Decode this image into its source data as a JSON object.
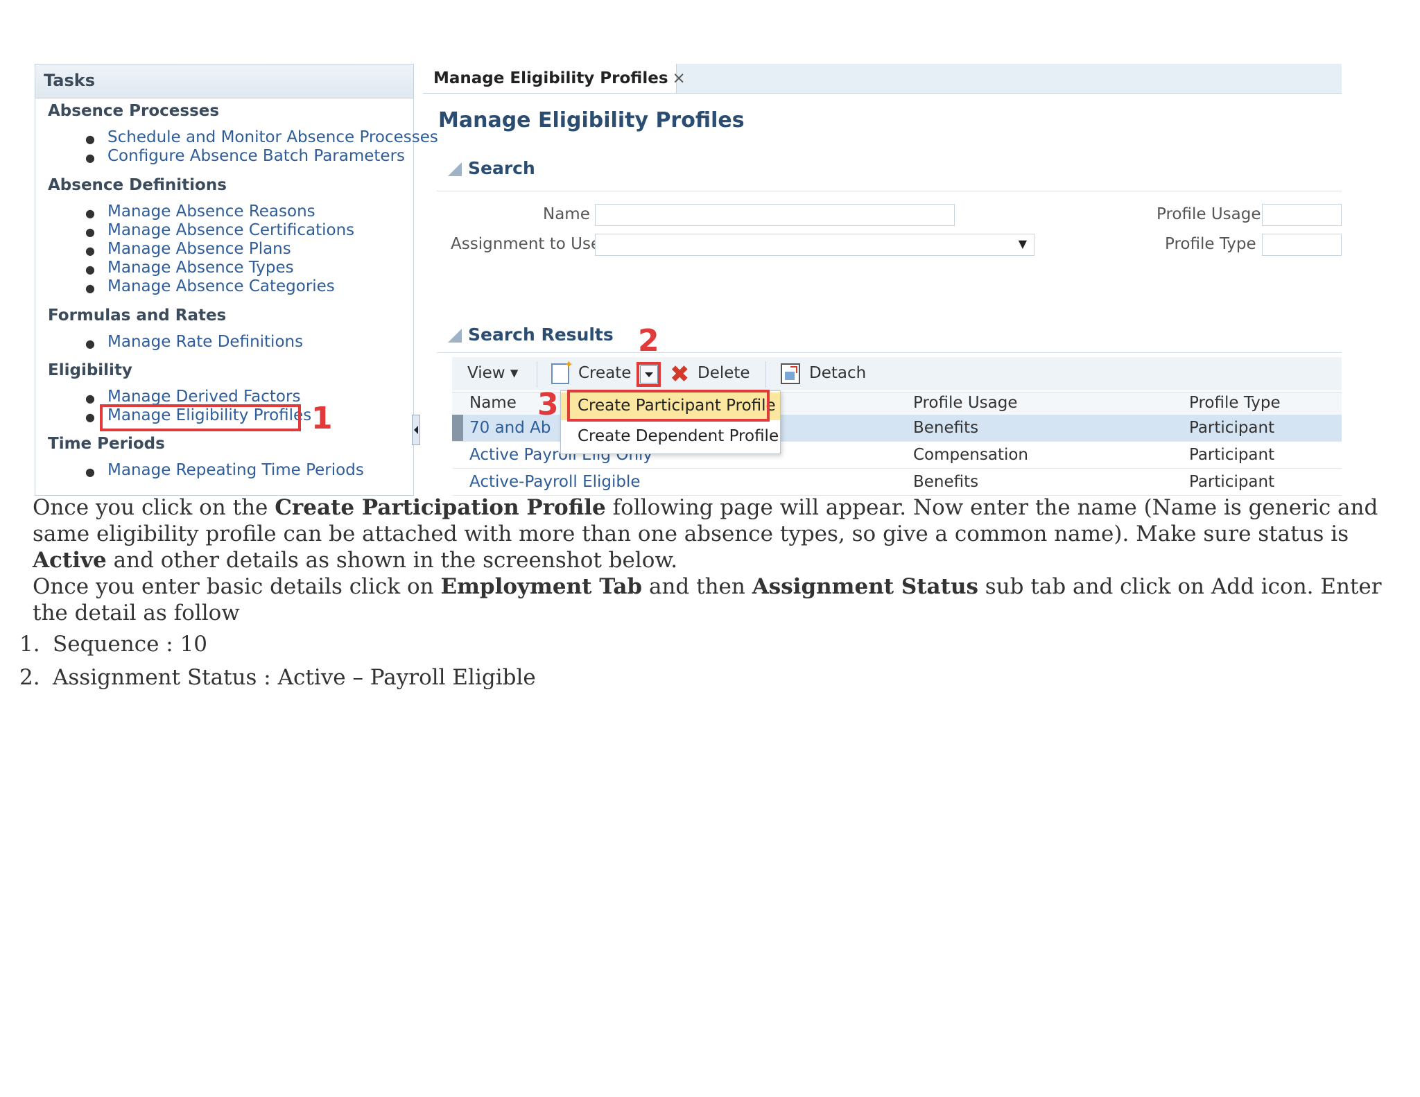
{
  "tasks_panel": {
    "title": "Tasks",
    "groups": [
      {
        "heading": "Absence Processes",
        "links": [
          "Schedule and Monitor Absence Processes",
          "Configure Absence Batch Parameters"
        ]
      },
      {
        "heading": "Absence Definitions",
        "links": [
          "Manage Absence Reasons",
          "Manage Absence Certifications",
          "Manage Absence Plans",
          "Manage Absence Types",
          "Manage Absence Categories"
        ]
      },
      {
        "heading": "Formulas and Rates",
        "links": [
          "Manage Rate Definitions"
        ]
      },
      {
        "heading": "Eligibility",
        "links": [
          "Manage Derived Factors",
          "Manage Eligibility Profiles"
        ]
      },
      {
        "heading": "Time Periods",
        "links": [
          "Manage Repeating Time Periods"
        ]
      }
    ]
  },
  "tab": {
    "label": "Manage Eligibility Profiles",
    "close": "×"
  },
  "page_title": "Manage Eligibility Profiles",
  "search": {
    "heading": "Search",
    "name_label": "Name",
    "assignment_label": "Assignment to Use",
    "profile_usage_label": "Profile Usage",
    "profile_type_label": "Profile Type",
    "select_arrow": "▼"
  },
  "results": {
    "heading": "Search Results",
    "toolbar": {
      "view": "View",
      "create": "Create",
      "delete": "Delete",
      "detach": "Detach"
    },
    "columns": [
      "Name",
      "Profile Usage",
      "Profile Type"
    ],
    "rows": [
      {
        "name": "70 and Ab",
        "usage": "Benefits",
        "type": "Participant"
      },
      {
        "name": "Active Payroll Elig Only",
        "usage": "Compensation",
        "type": "Participant"
      },
      {
        "name": "Active-Payroll Eligible",
        "usage": "Benefits",
        "type": "Participant"
      }
    ]
  },
  "create_menu": {
    "items": [
      "Create Participant Profile",
      "Create Dependent Profile"
    ]
  },
  "callouts": [
    "1",
    "2",
    "3"
  ],
  "document": {
    "para1": {
      "t1": "Once you click on the ",
      "b1": "Create Participation Profile",
      "t2": " following page will appear. Now enter the name (Name is generic and same eligibility profile can be attached with more than one absence types, so give a common name). Make sure status is ",
      "b2": "Active",
      "t3": " and other details as shown in the screenshot below."
    },
    "para2": {
      "t1": "Once you enter basic details click on ",
      "b1": "Employment Tab",
      "t2": " and then ",
      "b2": "Assignment Status",
      "t3": " sub tab and click on Add icon. Enter the detail as follow"
    },
    "list": [
      {
        "num": "1.",
        "text": "Sequence : 10"
      },
      {
        "num": "2.",
        "text": "Assignment Status : Active – Payroll Eligible"
      }
    ]
  },
  "colors": {
    "callout": "#e03a3a",
    "link": "#2e5d9a",
    "heading": "#2b4d72",
    "menu_highlight": "#fce7a0",
    "selected_row": "#d4e4f3"
  }
}
